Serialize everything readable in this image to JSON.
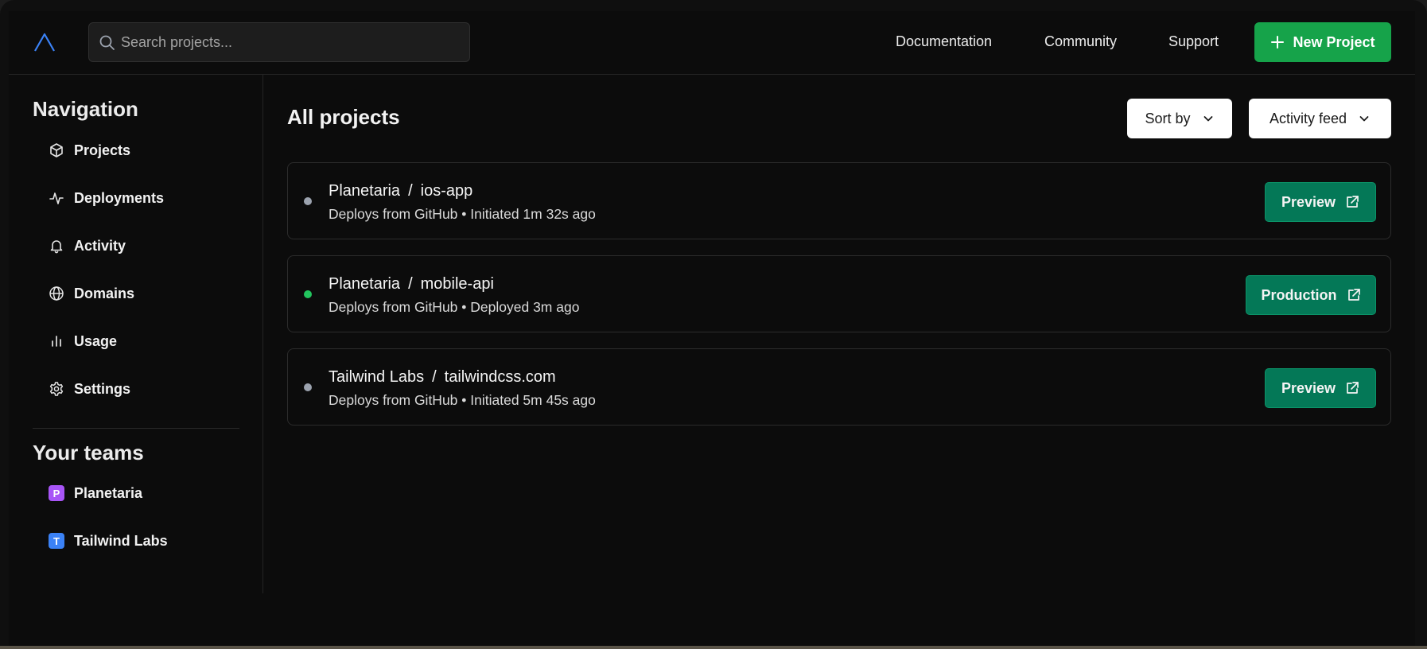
{
  "header": {
    "search_placeholder": "Search projects...",
    "nav": [
      "Documentation",
      "Community",
      "Support"
    ],
    "new_project_label": "New Project"
  },
  "sidebar": {
    "nav_heading": "Navigation",
    "items": [
      {
        "label": "Projects",
        "icon": "cube-icon"
      },
      {
        "label": "Deployments",
        "icon": "activity-pulse-icon"
      },
      {
        "label": "Activity",
        "icon": "bell-icon"
      },
      {
        "label": "Domains",
        "icon": "globe-icon"
      },
      {
        "label": "Usage",
        "icon": "bar-chart-icon"
      },
      {
        "label": "Settings",
        "icon": "gear-icon"
      }
    ],
    "teams_heading": "Your teams",
    "teams": [
      {
        "initial": "P",
        "label": "Planetaria",
        "color": "#a855f7"
      },
      {
        "initial": "T",
        "label": "Tailwind Labs",
        "color": "#3b82f6"
      }
    ]
  },
  "main": {
    "title": "All projects",
    "sort_label": "Sort by",
    "feed_label": "Activity feed",
    "projects": [
      {
        "team": "Planetaria",
        "separator": "/",
        "name": "ios-app",
        "subtitle": "Deploys from GitHub • Initiated 1m 32s ago",
        "status_color": "#9ca3af",
        "button": "Preview"
      },
      {
        "team": "Planetaria",
        "separator": "/",
        "name": "mobile-api",
        "subtitle": "Deploys from GitHub • Deployed 3m ago",
        "status_color": "#22c55e",
        "button": "Production"
      },
      {
        "team": "Tailwind Labs",
        "separator": "/",
        "name": "tailwindcss.com",
        "subtitle": "Deploys from GitHub • Initiated 5m 45s ago",
        "status_color": "#9ca3af",
        "button": "Preview"
      }
    ]
  },
  "colors": {
    "accent_green": "#16a34a",
    "button_green": "#047857",
    "logo_blue": "#3b82f6"
  }
}
